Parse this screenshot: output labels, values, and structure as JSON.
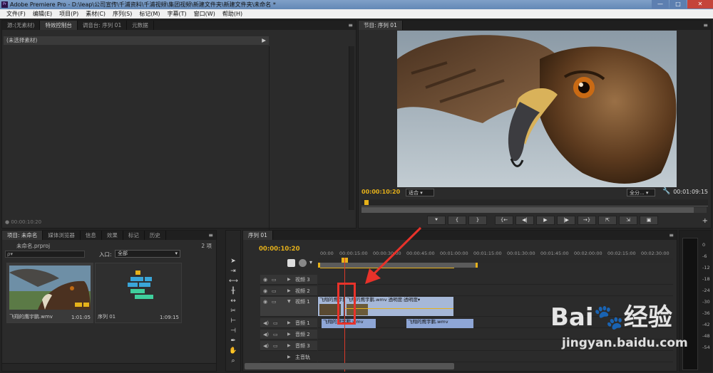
{
  "window": {
    "title": "Adobe Premiere Pro - D:\\leap\\公司宣传\\千浦资料\\千浦视频\\集团视频\\新建文件夹\\新建文件夹\\未命名 *",
    "app_icon": "Pr",
    "minimize": "—",
    "maximize": "□",
    "close": "✕"
  },
  "menu": [
    "文件(F)",
    "编辑(E)",
    "项目(P)",
    "素材(C)",
    "序列(S)",
    "标记(M)",
    "字幕(T)",
    "窗口(W)",
    "帮助(H)"
  ],
  "source_panel": {
    "tabs": [
      "源:(无素材)",
      "特效控制台",
      "调音台: 序列 01",
      "元数据"
    ],
    "active_tab": 1,
    "subheader": "(未选择素材)",
    "timecode": "● 00:00:10:20"
  },
  "program_panel": {
    "tab": "节目: 序列 01",
    "timecode_current": "00:00:10:20",
    "fit": "适合",
    "resolution": "全分...",
    "timecode_duration": "00:01:09:15",
    "transport": [
      "⯆",
      "{",
      "}",
      "{←",
      "◀|",
      "▶",
      "|▶",
      "→}",
      "⇱",
      "⇲",
      "▣"
    ]
  },
  "project_panel": {
    "tabs": [
      "项目: 未命名",
      "媒体浏览器",
      "信息",
      "效果",
      "标记",
      "历史"
    ],
    "filename": "未命名.prproj",
    "item_count": "2 项",
    "search_placeholder": "ρ▾",
    "in_label": "入口:",
    "in_value": "全部",
    "items": [
      {
        "name": "飞翔的鹰宇鹏.wmv",
        "duration": "1:01:05"
      },
      {
        "name": "序列 01",
        "duration": "1:09:15"
      }
    ]
  },
  "timeline": {
    "tab": "序列 01",
    "timecode": "00:00:10:20",
    "ticks": [
      "00:00",
      "00:00:15:00",
      "00:00:30:00",
      "00:00:45:00",
      "00:01:00:00",
      "00:01:15:00",
      "00:01:30:00",
      "00:01:45:00",
      "00:02:00:00",
      "00:02:15:00",
      "00:02:30:00"
    ],
    "tracks": {
      "video3": "视频 3",
      "video2": "视频 2",
      "video1": "视频 1",
      "audio1": "音频 1",
      "audio2": "音频 2",
      "audio3": "音频 3",
      "master": "主音轨"
    },
    "clips": {
      "v1a": "飞翔的鹰宇鹏",
      "v1b": "飞翔的鹰宇鹏.wmv  透明度:透明度▾",
      "a1a": "飞翔的鹰宇鹏.wmv",
      "a1b": "飞翔的鹰宇鹏.wmv"
    }
  },
  "meters": {
    "labels": [
      "0",
      "-6",
      "-12",
      "-18",
      "-24",
      "-30",
      "-36",
      "-42",
      "-48",
      "-54"
    ]
  },
  "watermark": {
    "text": "Bai🐾经验",
    "url": "jingyan.baidu.com"
  },
  "colors": {
    "accent": "#e6b11a",
    "clip_video": "#a6b8d8",
    "clip_audio": "#8ea6d6",
    "annotation": "#e8322a"
  }
}
